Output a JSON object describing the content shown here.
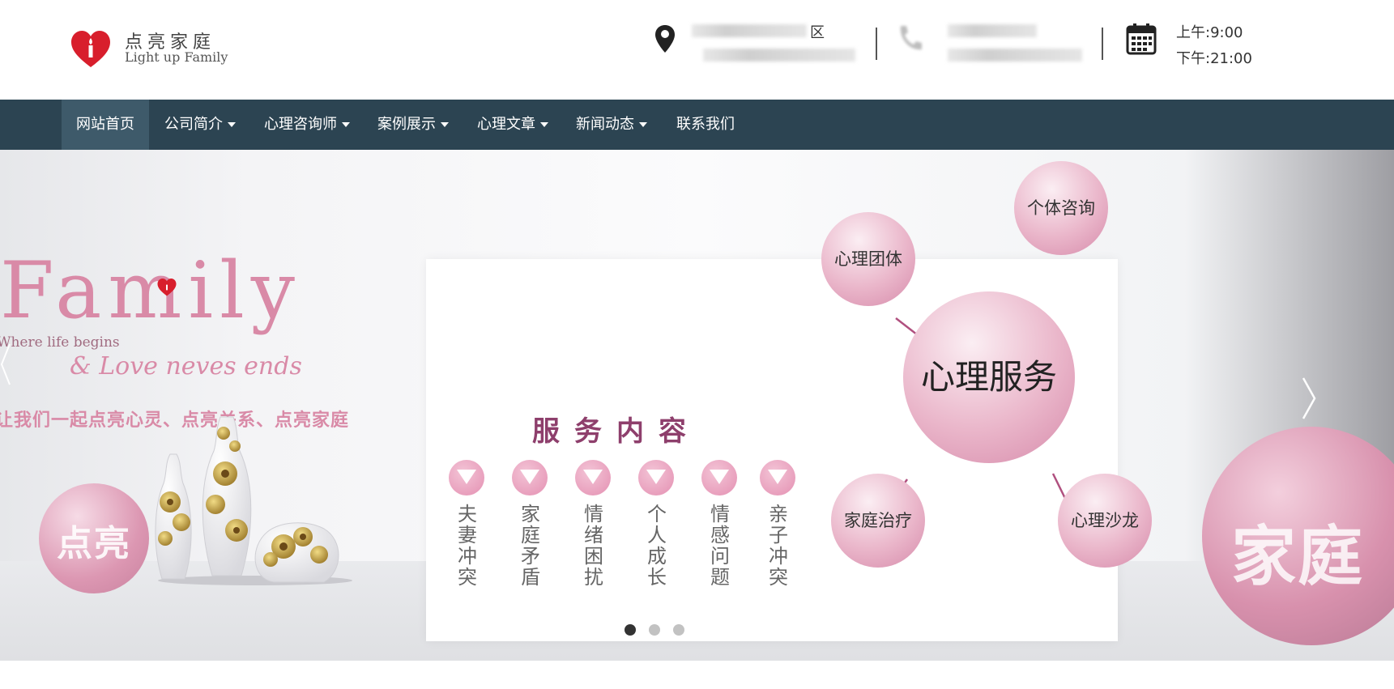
{
  "brand": {
    "name_cn": "点亮家庭",
    "name_en": "Light up Family",
    "logo_icon": "heart-candle-icon",
    "brand_color": "#d81e2c"
  },
  "header": {
    "address_partial": "区",
    "hours_morning": "上午:9:00",
    "hours_evening": "下午:21:00",
    "icons": {
      "address": "map-pin-icon",
      "phone": "phone-icon",
      "hours": "calendar-icon"
    }
  },
  "nav": {
    "background": "#2c4452",
    "active_background": "#3e5a6a",
    "items": [
      {
        "label": "网站首页",
        "dropdown": false,
        "active": true
      },
      {
        "label": "公司简介",
        "dropdown": true,
        "active": false
      },
      {
        "label": "心理咨询师",
        "dropdown": true,
        "active": false
      },
      {
        "label": "案例展示",
        "dropdown": true,
        "active": false
      },
      {
        "label": "心理文章",
        "dropdown": true,
        "active": false
      },
      {
        "label": "新闻动态",
        "dropdown": true,
        "active": false
      },
      {
        "label": "联系我们",
        "dropdown": false,
        "active": false
      }
    ]
  },
  "banner": {
    "left_slide": {
      "title": "Family",
      "tagline": "Where life begins",
      "love": "& Love neves ends",
      "slogan": "让我们一起点亮心灵、点亮关系、点亮家庭",
      "sphere_text": "点亮"
    },
    "center_slide": {
      "services_title": "服务内容",
      "services": [
        "夫妻冲突",
        "家庭矛盾",
        "情绪困扰",
        "个人成长",
        "情感问题",
        "亲子冲突"
      ],
      "center_bubble": "心理服务",
      "bubbles": [
        "个体咨询",
        "心理团体",
        "家庭治疗",
        "心理沙龙"
      ],
      "accent": "#e490b2",
      "title_color": "#8e3f6c"
    },
    "right_slide": {
      "sphere_text": "家庭"
    },
    "controls": {
      "prev": "‹",
      "next": "›"
    },
    "indicators": {
      "count": 3,
      "active_index": 0
    }
  }
}
